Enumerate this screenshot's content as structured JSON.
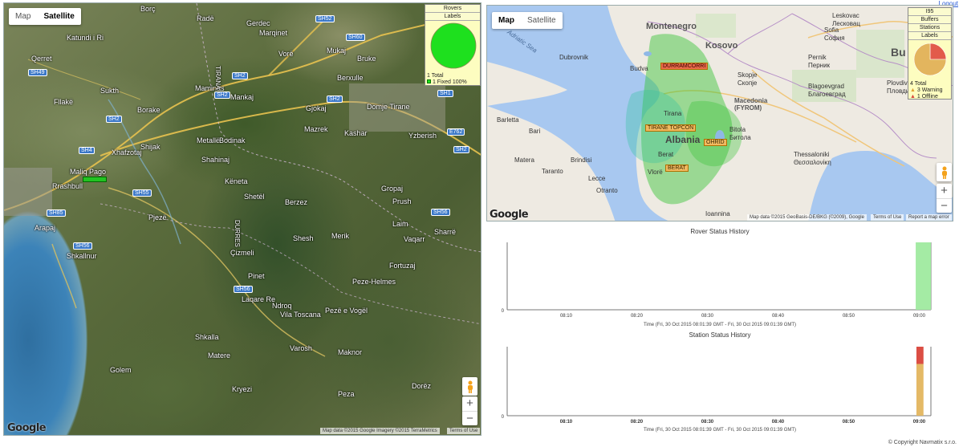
{
  "left_map": {
    "map_type": {
      "map_label": "Map",
      "satellite_label": "Satellite",
      "active": "satellite"
    },
    "places": [
      {
        "text": "Borç"
      },
      {
        "text": "Radë"
      },
      {
        "text": "Gerdec"
      },
      {
        "text": "Katundi i Ri"
      },
      {
        "text": "Qerret"
      },
      {
        "text": "Marqinet"
      },
      {
        "text": "Vorë"
      },
      {
        "text": "Mukaj"
      },
      {
        "text": "Bruke"
      },
      {
        "text": "Sukth"
      },
      {
        "text": "Maminas"
      },
      {
        "text": "Mankaj"
      },
      {
        "text": "Berxulle"
      },
      {
        "text": "Fllakë"
      },
      {
        "text": "Borake"
      },
      {
        "text": "Gjokaj"
      },
      {
        "text": "Domje Tirane"
      },
      {
        "text": "Xhafzotaj"
      },
      {
        "text": "Shijak"
      },
      {
        "text": "Metallë"
      },
      {
        "text": "Bodinak"
      },
      {
        "text": "Mazrek"
      },
      {
        "text": "Kashar"
      },
      {
        "text": "Yzberish"
      },
      {
        "text": "Shahinaj"
      },
      {
        "text": "Maliq Pago"
      },
      {
        "text": "Rrashbull"
      },
      {
        "text": "Këneta"
      },
      {
        "text": "Shetël"
      },
      {
        "text": "Berzez"
      },
      {
        "text": "Gropaj"
      },
      {
        "text": "Prush"
      },
      {
        "text": "Pjezë"
      },
      {
        "text": "Arapaj"
      },
      {
        "text": "Laim"
      },
      {
        "text": "Sharrë"
      },
      {
        "text": "Shesh"
      },
      {
        "text": "Merik"
      },
      {
        "text": "Vaqarr"
      },
      {
        "text": "Shkallnur"
      },
      {
        "text": "Çizmeli"
      },
      {
        "text": "Fortuzaj"
      },
      {
        "text": "Pinet"
      },
      {
        "text": "Peze-Helmes"
      },
      {
        "text": "Laqare Re"
      },
      {
        "text": "Ndroq"
      },
      {
        "text": "Vila Toscana"
      },
      {
        "text": "Pezë e Vogël"
      },
      {
        "text": "Shkalla"
      },
      {
        "text": "Varosh"
      },
      {
        "text": "Matere"
      },
      {
        "text": "Maknor"
      },
      {
        "text": "Golem"
      },
      {
        "text": "Dorëz"
      },
      {
        "text": "Kryezi"
      },
      {
        "text": "Peza"
      },
      {
        "text": "TIRANA"
      },
      {
        "text": "DURRES"
      }
    ],
    "road_badges": [
      "SH52",
      "SH60",
      "SH2",
      "SH2",
      "SH1",
      "SH49",
      "SH2",
      "SH4",
      "SH2",
      "SH55",
      "SH56",
      "SH85",
      "SH56",
      "SH56",
      "E762",
      "SH2"
    ],
    "rover_label": "",
    "legend": {
      "btn_rovers": "Rovers",
      "btn_labels": "Labels",
      "total_text": "1 Total",
      "fixed_text": "1 Fixed 100%",
      "pie_color": "#1ee01e"
    },
    "google_logo": "Google",
    "attribution": "Map data ©2015 Google Imagery ©2015 TerraMetrics",
    "terms": "Terms of Use",
    "zoom_in": "+",
    "zoom_out": "−"
  },
  "right_map": {
    "logout": "Logout",
    "map_type": {
      "map_label": "Map",
      "satellite_label": "Satellite",
      "active": "map"
    },
    "countries": [
      {
        "text": "Montenegro"
      },
      {
        "text": "Kosovo"
      },
      {
        "text": "Albania"
      },
      {
        "text": "Macedonia (FYROM)"
      },
      {
        "text": "Bu"
      }
    ],
    "places": [
      {
        "text": "Dubrovnik"
      },
      {
        "text": "Budva"
      },
      {
        "text": "Skopje"
      },
      {
        "text": "Скопје"
      },
      {
        "text": "Sofia"
      },
      {
        "text": "София"
      },
      {
        "text": "Pernik"
      },
      {
        "text": "Перник"
      },
      {
        "text": "Blagoevgrad"
      },
      {
        "text": "Благоевград"
      },
      {
        "text": "Plovdiv"
      },
      {
        "text": "Пловди"
      },
      {
        "text": "Barletta"
      },
      {
        "text": "Bari"
      },
      {
        "text": "Tirana"
      },
      {
        "text": "Bitola"
      },
      {
        "text": "Битола"
      },
      {
        "text": "Matera"
      },
      {
        "text": "Brindisi"
      },
      {
        "text": "Berat"
      },
      {
        "text": "Thessaloniki"
      },
      {
        "text": "Θεσσαλονίκη"
      },
      {
        "text": "Taranto"
      },
      {
        "text": "Lecce"
      },
      {
        "text": "Vlorë"
      },
      {
        "text": "Otranto"
      },
      {
        "text": "Ioannina"
      },
      {
        "text": "Leskovac"
      },
      {
        "text": "Лесковац"
      },
      {
        "text": "Adriatic Sea"
      }
    ],
    "stations": [
      {
        "text": "DURRAMCORRI",
        "status": "offline"
      },
      {
        "text": "TIRANE TOPCON",
        "status": "warning"
      },
      {
        "text": "OHRID",
        "status": "warning"
      },
      {
        "text": "BERAT",
        "status": "warning"
      }
    ],
    "legend": {
      "btn_i95": "I95",
      "btn_buffers": "Buffers",
      "btn_stations": "Stations",
      "btn_labels": "Labels",
      "total_text": "4 Total",
      "warning_text": "3 Warning",
      "offline_text": "1 Offline",
      "warning_color": "#e3b55e",
      "offline_color": "#e25b4b"
    },
    "google_logo": "Google",
    "attribution": "Map data ©2015 GeoBasis-DE/BKG (©2009), Google",
    "terms": "Terms of Use",
    "report": "Report a map error",
    "zoom_in": "+",
    "zoom_out": "−"
  },
  "rover_chart": {
    "title": "Rover Status History",
    "caption": "Time (Fri, 30 Oct 2015 08:01:39 GMT - Fri, 30 Oct 2015 09:01:39 GMT)",
    "y_zero": "0"
  },
  "station_chart": {
    "title": "Station Status History",
    "caption": "Time (Fri, 30 Oct 2015 08:01:39 GMT - Fri, 30 Oct 2015 09:01:39 GMT)",
    "y_zero": "0"
  },
  "chart_data": [
    {
      "type": "area",
      "title": "Rover Status History",
      "xlabel": "Time (Fri, 30 Oct 2015 08:01:39 GMT - Fri, 30 Oct 2015 09:01:39 GMT)",
      "x_ticks": [
        "08:10",
        "08:20",
        "08:30",
        "08:40",
        "08:50",
        "09:00"
      ],
      "x_start_min": 1.65,
      "x_end_min": 61.65,
      "ylim": [
        0,
        1
      ],
      "series": [
        {
          "name": "Fixed",
          "color": "#9fea9f",
          "x_min": [
            59.5,
            61.65
          ],
          "values": [
            1,
            1
          ]
        }
      ]
    },
    {
      "type": "bar",
      "title": "Station Status History",
      "xlabel": "Time (Fri, 30 Oct 2015 08:01:39 GMT - Fri, 30 Oct 2015 09:01:39 GMT)",
      "x_ticks": [
        "08:10",
        "08:20",
        "08:30",
        "08:40",
        "08:50",
        "09:00"
      ],
      "x_start_min": 1.65,
      "x_end_min": 61.65,
      "ylim": [
        0,
        4
      ],
      "series": [
        {
          "name": "Warning",
          "color": "#e3b55e",
          "x_min": [
            59.6,
            60.6
          ],
          "values": [
            3,
            3
          ]
        },
        {
          "name": "Offline",
          "color": "#d9453a",
          "x_min": [
            59.6,
            60.6
          ],
          "values": [
            1,
            1
          ]
        }
      ]
    }
  ],
  "footer": {
    "copyright": "© Copyright Navmatix s.r.o."
  }
}
